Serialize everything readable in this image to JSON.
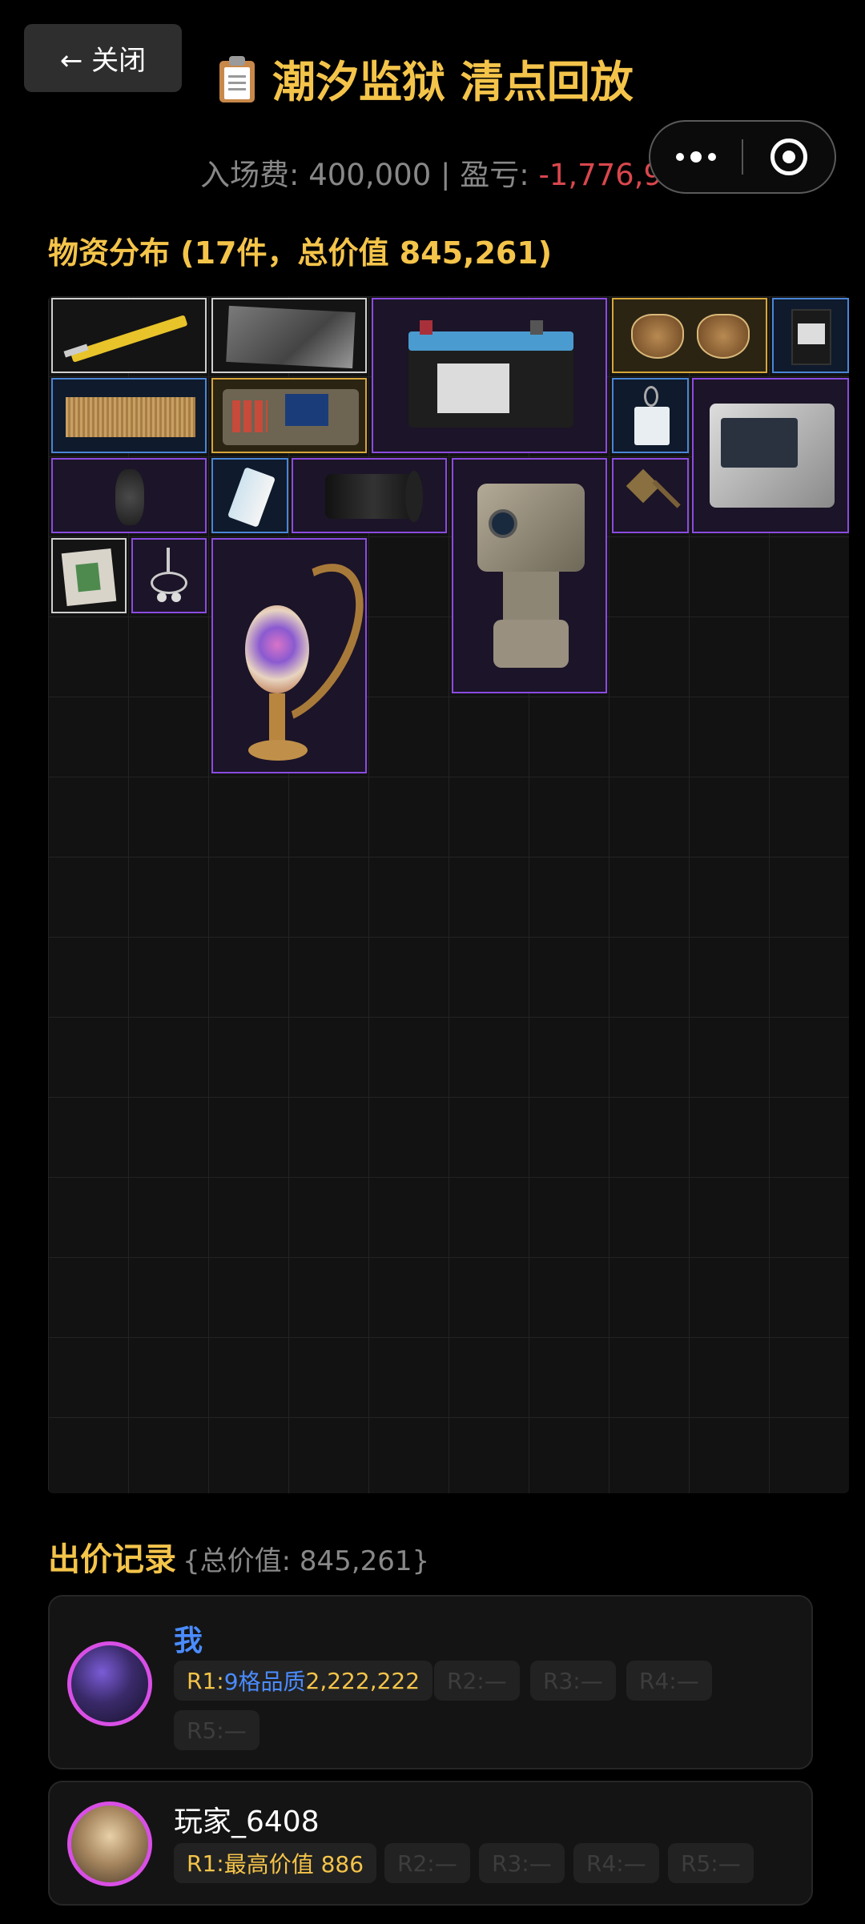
{
  "header": {
    "close_label": "← 关闭",
    "title": "潮汐监狱 清点回放",
    "fee_label": "入场费: 400,000 | 盈亏: ",
    "profit_value": "-1,776,961"
  },
  "inventory": {
    "section_title": "物资分布 (17件，总价值 845,261)",
    "items": [
      {
        "name": "utility-knife",
        "rarity": "white"
      },
      {
        "name": "photo",
        "rarity": "white"
      },
      {
        "name": "car-battery",
        "rarity": "purple"
      },
      {
        "name": "aviator-sunglasses",
        "rarity": "gold"
      },
      {
        "name": "circuit-device",
        "rarity": "blue"
      },
      {
        "name": "gold-plate",
        "rarity": "blue"
      },
      {
        "name": "handheld-scanner",
        "rarity": "gold"
      },
      {
        "name": "id-badge",
        "rarity": "blue"
      },
      {
        "name": "incubator-machine",
        "rarity": "purple"
      },
      {
        "name": "dark-stone",
        "rarity": "purple"
      },
      {
        "name": "small-canister",
        "rarity": "blue"
      },
      {
        "name": "camera-lens",
        "rarity": "purple"
      },
      {
        "name": "thermal-camera",
        "rarity": "purple"
      },
      {
        "name": "spearhead",
        "rarity": "purple"
      },
      {
        "name": "matchbox",
        "rarity": "white"
      },
      {
        "name": "earring",
        "rarity": "purple"
      },
      {
        "name": "moon-lamp",
        "rarity": "purple"
      }
    ]
  },
  "bids": {
    "title": "出价记录",
    "subtitle": "{总价值: 845,261}",
    "records": [
      {
        "player": "我",
        "r1_prefix": "R1:",
        "r1_highlight": "9格品质",
        "r1_value": " 2,222,222",
        "r2": "R2:—",
        "r3": "R3:—",
        "r4": "R4:—",
        "r5": "R5:—"
      },
      {
        "player": "玩家_6408",
        "r1_prefix": "R1:",
        "r1_highlight": "",
        "r1_value": "最高价值 886",
        "r2": "R2:—",
        "r3": "R3:—",
        "r4": "R4:—",
        "r5": "R5:—"
      }
    ]
  }
}
